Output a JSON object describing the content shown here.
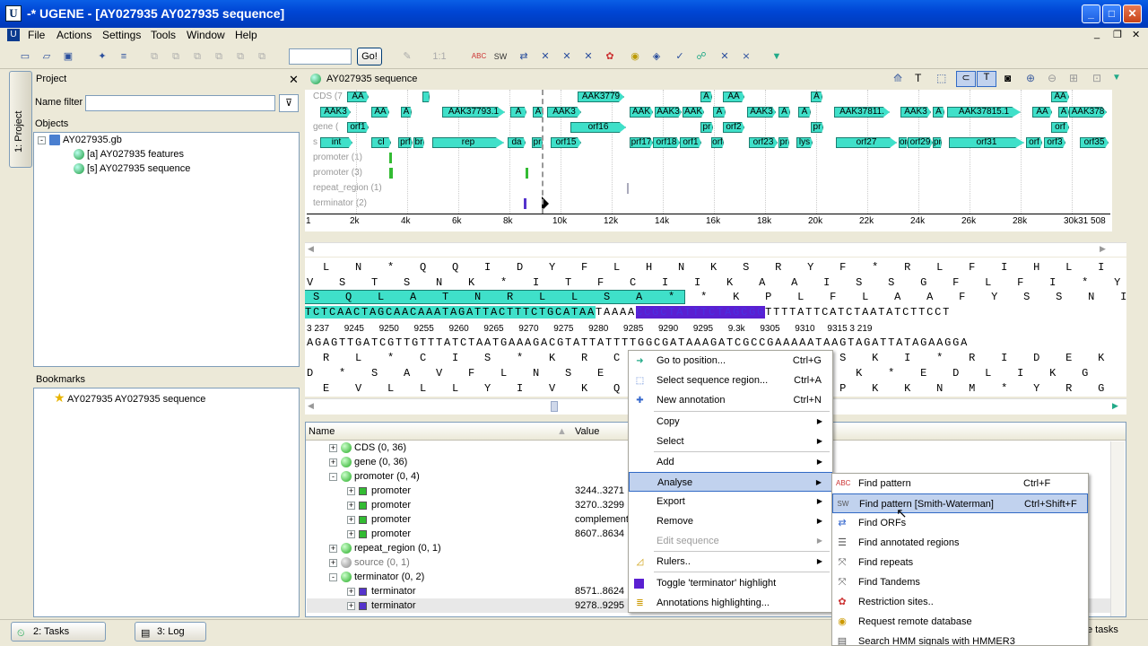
{
  "window": {
    "title": "-* UGENE - [AY027935 AY027935 sequence]",
    "app_icon": "U"
  },
  "menu": [
    "File",
    "Actions",
    "Settings",
    "Tools",
    "Window",
    "Help"
  ],
  "toolbar": {
    "go_label": "Go!",
    "zoom_label": "1:1",
    "icon_abc": "ABC",
    "icon_sw": "SW"
  },
  "project": {
    "title": "Project",
    "side_tab": "1: Project",
    "filter_label": "Name filter",
    "objects_label": "Objects",
    "file": "AY027935.gb",
    "features": "[a] AY027935 features",
    "sequence": "[s] AY027935 sequence"
  },
  "bookmarks": {
    "title": "Bookmarks",
    "item": "AY027935 AY027935 sequence"
  },
  "seq_panel": {
    "title": "AY027935 sequence"
  },
  "tracks": [
    "CDS (7",
    "gene (",
    "s",
    "promoter (1)",
    "promoter (3)",
    "repeat_region (1)",
    "terminator (2)"
  ],
  "features_row1": [
    "AA",
    "AAK3779",
    "A",
    "AA",
    "A",
    "AA"
  ],
  "features_row2": [
    "AAK3",
    "AA",
    "A",
    "AAK37793.1",
    "A",
    "A",
    "AAK3",
    "AAK",
    "AAK3",
    "AAK",
    "A",
    "AAK3",
    "A",
    "A",
    "AAK37811.",
    "AAK3",
    "A",
    "AAK37815.1",
    "AA",
    "A",
    "AAK378"
  ],
  "features_row3": [
    "orf1",
    "orf16",
    "pr",
    "orf2",
    "pr",
    "orf"
  ],
  "features_row4": [
    "int",
    "cI",
    "prf",
    "br",
    "rep",
    "da",
    "pr",
    "orf15",
    "prf17",
    "orf18",
    "orf1",
    "orf",
    "orf23",
    "pr",
    "lys",
    "orf27",
    "orf",
    "orf29",
    "prf",
    "orf31",
    "orf",
    "orf3",
    "orf35"
  ],
  "ruler": [
    "1",
    "2k",
    "4k",
    "6k",
    "8k",
    "10k",
    "12k",
    "14k",
    "16k",
    "18k",
    "20k",
    "22k",
    "24k",
    "26k",
    "28k",
    "30k31 508"
  ],
  "sequence": {
    "aa_top1": "  L   N   *   Q   Q   I   D   Y   F   L   H   N   K   S   R   Y   F   *   R   L   F   I   H   L   I   S   S",
    "aa_top2": "V   S   T   S   N   K   *   I   T   F   C   I   I   K   A   A   I   S   S   G   F   L   F   I   *   Y   L   P",
    "aa_top3_hl": " S   Q   L   A   T   N   R   L   L   S   A   * ",
    "aa_top3_rest": "  *   K   P   L   F   L   A   A   F   Y   S   S   N   I   F   L",
    "dna_a": "TCTCAACTAGCAACAAATAGATTACTTTCTGCATAA",
    "dna_b": "TAAAA",
    "dna_c": "CCGCTATTTCTAGCGG",
    "dna_d": "TTTTATTCATCTAATATCTTCCT",
    "coords": "3 237      9245      9250      9255      9260      9265      9270      9275      9280      9285      9290      9295      9.3k      9305      9310     9315 3 219",
    "dna_rev": "AGAGTTGATCGTTGTTTATCTAATGAAAGACGTATTATTTTGGCGATAAAGATCGCCGAAAAATAAGTAGATTATAGAAGGA",
    "aa_bot1": "  R   L   *   C   I   S   *   K   R   C                       R   S   K   I   *   R   I   D   E   K",
    "aa_bot2": "D   *   S   A   V   F   L   N   S   E   A                       A   K   *   E   D   L   I   K   G",
    "aa_bot3": "  E   V   L   L   L   Y   I   V   K   Q   M                       P   K   K   N   M   *   Y   R   G"
  },
  "annotations": {
    "col_name": "Name",
    "col_value": "Value",
    "rows": [
      {
        "name": "CDS",
        "count": "(0, 36)"
      },
      {
        "name": "gene",
        "count": "(0, 36)"
      },
      {
        "name": "promoter",
        "count": "(0, 4)"
      },
      {
        "name": "promoter",
        "value": "3244..3271"
      },
      {
        "name": "promoter",
        "value": "3270..3299"
      },
      {
        "name": "promoter",
        "value": "complement("
      },
      {
        "name": "promoter",
        "value": "8607..8634"
      },
      {
        "name": "repeat_region",
        "count": "(0, 1)"
      },
      {
        "name": "source",
        "count": "(0, 1)"
      },
      {
        "name": "terminator",
        "count": "(0, 2)"
      },
      {
        "name": "terminator",
        "value": "8571..8624"
      },
      {
        "name": "terminator",
        "value": "9278..9295"
      }
    ]
  },
  "bottom": {
    "tasks": "2: Tasks",
    "log": "3: Log",
    "right": "e tasks"
  },
  "context_menu": [
    {
      "label": "Go to position...",
      "shortcut": "Ctrl+G"
    },
    {
      "label": "Select sequence region...",
      "shortcut": "Ctrl+A"
    },
    {
      "label": "New annotation",
      "shortcut": "Ctrl+N"
    },
    {
      "label": "Copy"
    },
    {
      "label": "Select"
    },
    {
      "label": "Add"
    },
    {
      "label": "Analyse"
    },
    {
      "label": "Export"
    },
    {
      "label": "Remove"
    },
    {
      "label": "Edit sequence"
    },
    {
      "label": "Rulers.."
    },
    {
      "label": "Toggle 'terminator' highlight"
    },
    {
      "label": "Annotations highlighting..."
    }
  ],
  "submenu": [
    {
      "label": "Find pattern",
      "shortcut": "Ctrl+F"
    },
    {
      "label": "Find pattern [Smith-Waterman]",
      "shortcut": "Ctrl+Shift+F"
    },
    {
      "label": "Find ORFs"
    },
    {
      "label": "Find annotated regions"
    },
    {
      "label": "Find repeats"
    },
    {
      "label": "Find Tandems"
    },
    {
      "label": "Restriction sites.."
    },
    {
      "label": "Request remote database"
    },
    {
      "label": "Search HMM signals with HMMER3"
    }
  ],
  "colors": {
    "feature": "#3fe0c9",
    "selection": "#5a1fd1",
    "terminator": "#5533cc",
    "promoter": "#33bb33"
  }
}
